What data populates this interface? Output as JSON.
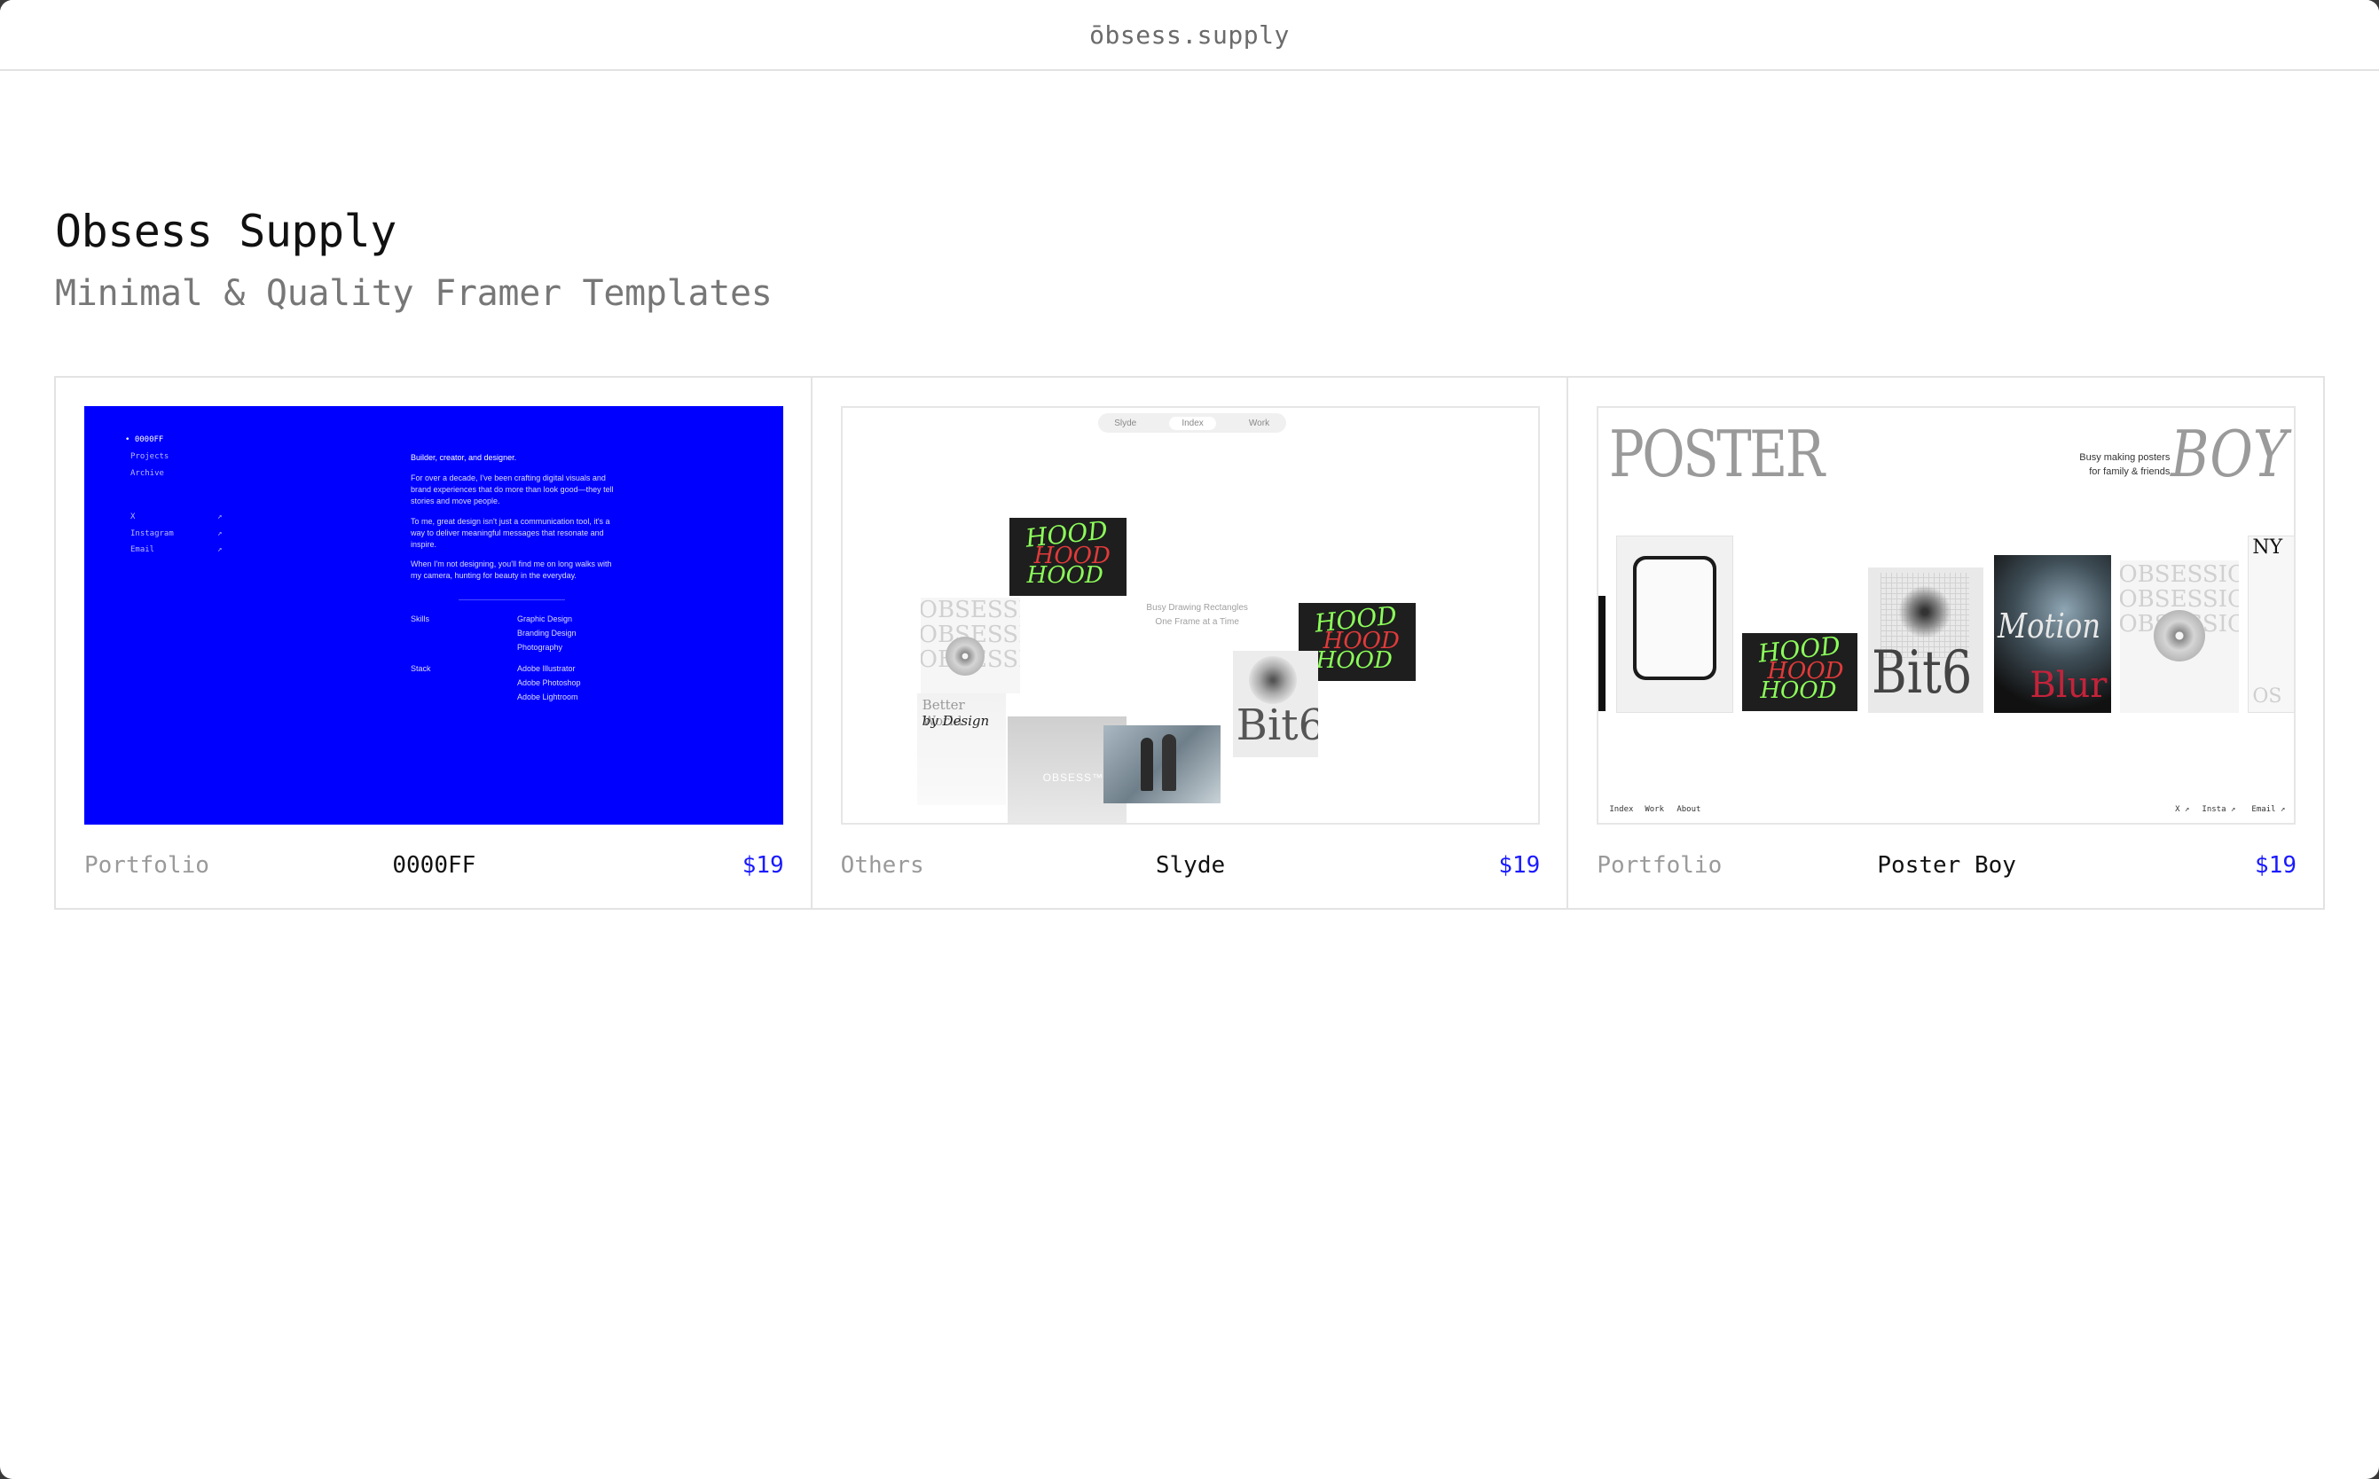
{
  "topbar": {
    "site_name": "ōbsess.supply"
  },
  "hero": {
    "title": "Obsess Supply",
    "subtitle": "Minimal & Quality Framer Templates"
  },
  "templates": [
    {
      "category": "Portfolio",
      "name": "0000FF",
      "price": "$19",
      "preview": {
        "nav_active": "• 0000FF",
        "nav": [
          "Projects",
          "Archive"
        ],
        "links": [
          "X",
          "Instagram",
          "Email"
        ],
        "arrow": "↗",
        "intro": "Builder, creator, and designer.",
        "para1": "For over a decade, I've been crafting digital visuals and brand experiences that do more than look good—they tell stories and move people.",
        "para2": "To me, great design isn't just a communication tool, it's a way to deliver meaningful messages that resonate and inspire.",
        "para3": "When I'm not designing, you'll find me on long walks with my camera, hunting for beauty in the everyday.",
        "skills_label": "Skills",
        "skills": [
          "Graphic Design",
          "Branding Design",
          "Photography"
        ],
        "stack_label": "Stack",
        "stack": [
          "Adobe Illustrator",
          "Adobe Photoshop",
          "Adobe Lightroom"
        ]
      }
    },
    {
      "category": "Others",
      "name": "Slyde",
      "price": "$19",
      "preview": {
        "tabs": [
          "Slyde",
          "Index",
          "Work"
        ],
        "tagline1": "Busy Drawing Rectangles",
        "tagline2": "One Frame at a Time",
        "poster_word_1": "HOOD",
        "poster_word_2": "HOOD",
        "poster_word_3": "HOOD",
        "obsession": "OBSESSION\nOBSESSION\nOBSESSION",
        "better_world": "Better World",
        "by_design": "by Design",
        "bit6": "Bit6",
        "obsess_mark": "OBSESS™"
      }
    },
    {
      "category": "Portfolio",
      "name": "Poster Boy",
      "price": "$19",
      "preview": {
        "word_left": "POSTER",
        "word_right": "BOY",
        "tagline1": "Busy making posters",
        "tagline2": "for family & friends",
        "bit6": "Bit6",
        "motion": "Motion",
        "blur": "Blur",
        "ny": "NY",
        "os": "OS",
        "nav": [
          "Index",
          "Work",
          "About"
        ],
        "links": [
          "X ↗",
          "Insta ↗",
          "Email ↗"
        ]
      }
    }
  ],
  "colors": {
    "accent_blue": "#0000ff",
    "price_color": "#1a1aff"
  }
}
